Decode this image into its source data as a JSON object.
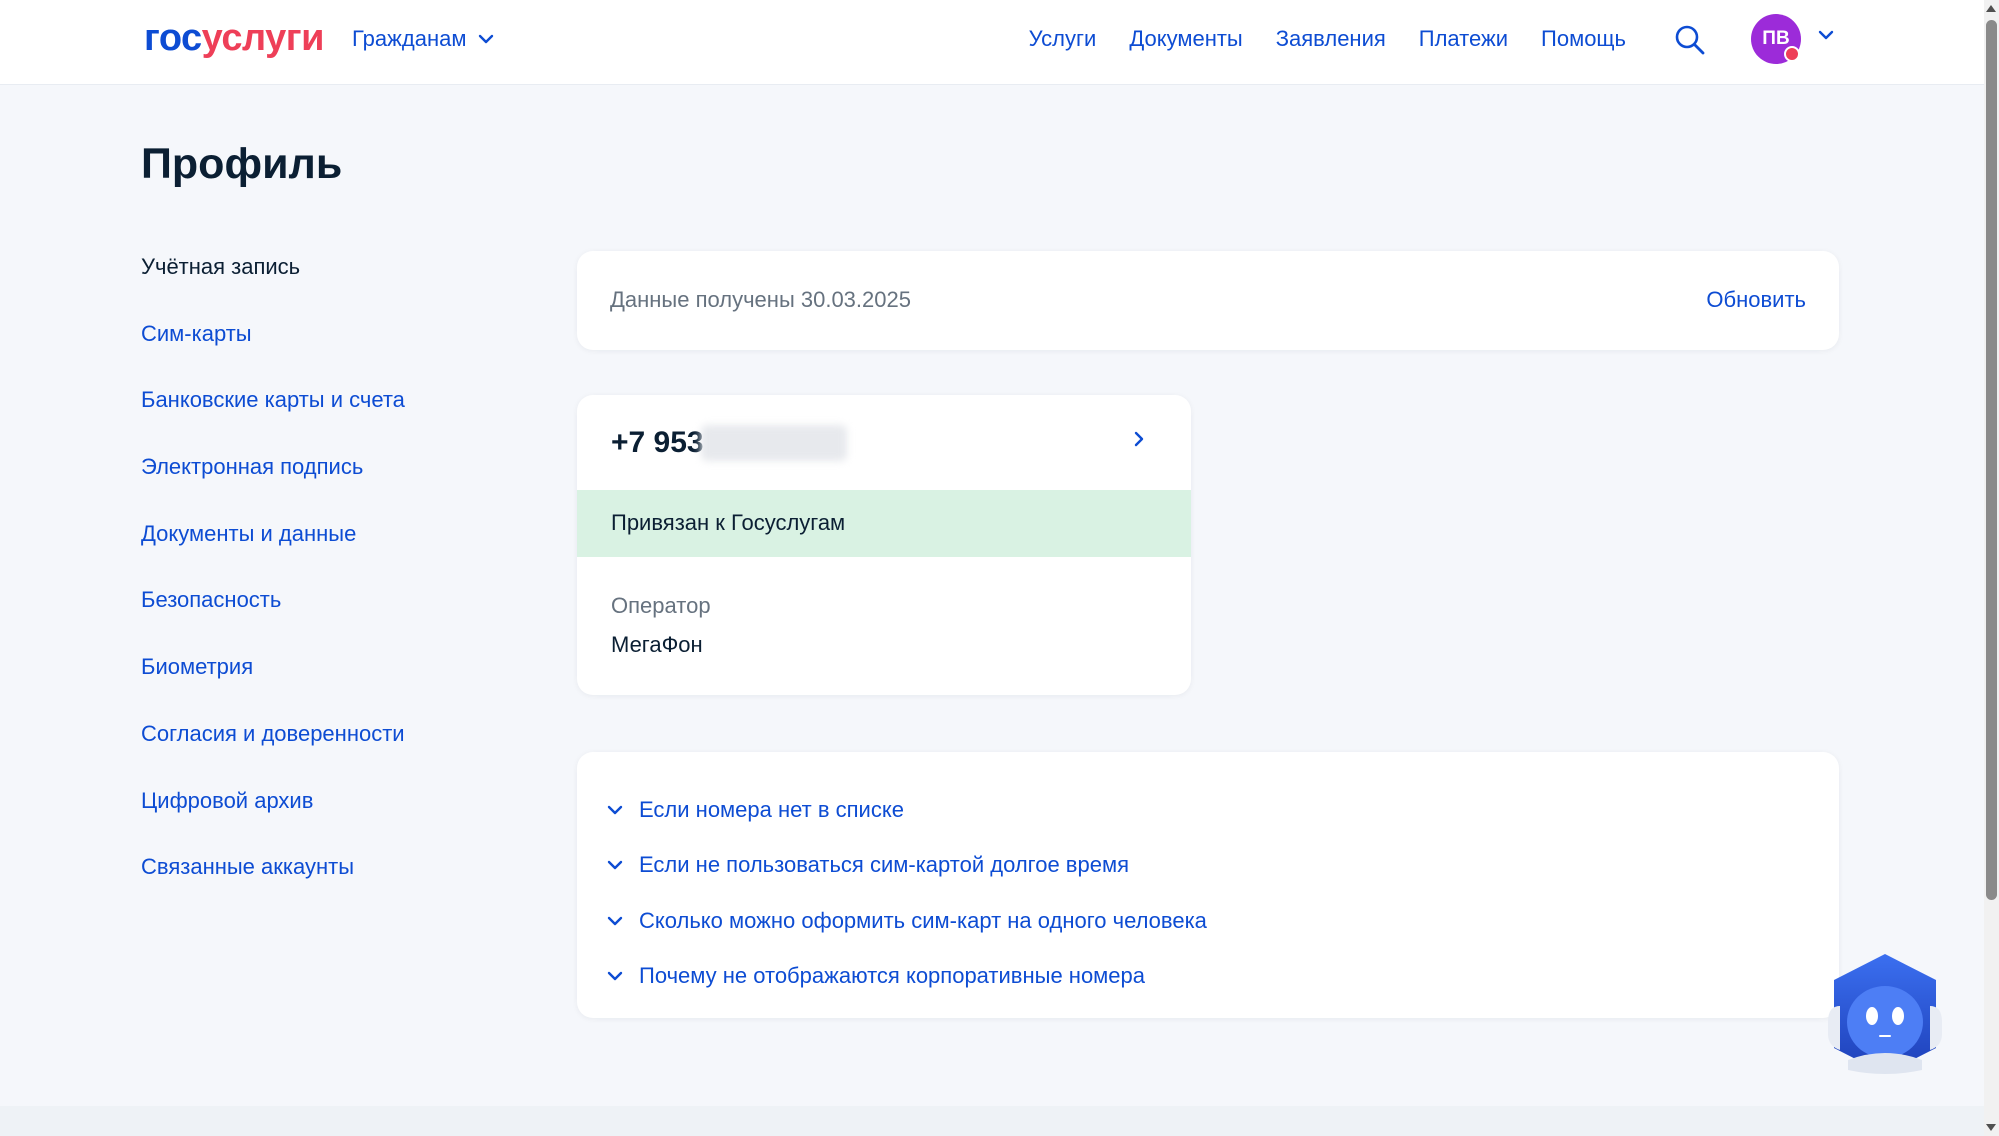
{
  "header": {
    "logo": {
      "part1": "гос",
      "part2": "услуги"
    },
    "audience": "Гражданам",
    "nav": [
      "Услуги",
      "Документы",
      "Заявления",
      "Платежи",
      "Помощь"
    ],
    "avatar_initials": "ПВ"
  },
  "page": {
    "title": "Профиль"
  },
  "sidebar": {
    "items": [
      {
        "label": "Учётная запись",
        "active": true
      },
      {
        "label": "Сим-карты"
      },
      {
        "label": "Банковские карты и счета"
      },
      {
        "label": "Электронная подпись"
      },
      {
        "label": "Документы и данные"
      },
      {
        "label": "Безопасность"
      },
      {
        "label": "Биометрия"
      },
      {
        "label": "Согласия и доверенности"
      },
      {
        "label": "Цифровой архив"
      },
      {
        "label": "Связанные аккаунты"
      }
    ]
  },
  "data_status": {
    "text": "Данные получены 30.03.2025",
    "refresh_label": "Обновить"
  },
  "sim": {
    "phone_prefix": "+7 953",
    "status": "Привязан к Госуслугам",
    "operator_label": "Оператор",
    "operator_value": "МегаФон"
  },
  "faq": {
    "items": [
      "Если номера нет в списке",
      "Если не пользоваться сим-картой долгое время",
      "Сколько можно оформить сим-карт на одного человека",
      "Почему не отображаются корпоративные номера"
    ]
  },
  "colors": {
    "brand_blue": "#0d4cd3",
    "brand_red": "#ee3f58",
    "success_bg": "#d9f2e3",
    "avatar_bg": "#9c2bd9",
    "page_bg": "#f5f7fb"
  },
  "icons": {
    "search": "search-icon",
    "chevron_down": "chevron-down-icon",
    "chevron_right": "chevron-right-icon",
    "assistant": "assistant-robot-icon"
  }
}
